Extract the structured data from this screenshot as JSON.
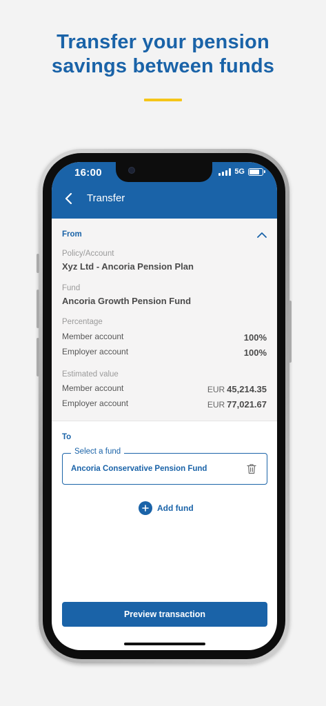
{
  "promo": {
    "headline_line1": "Transfer your pension",
    "headline_line2": "savings between funds",
    "accent_color": "#f5c518"
  },
  "status_bar": {
    "time": "16:00",
    "network": "5G"
  },
  "header": {
    "title": "Transfer",
    "back_icon": "chevron-left-icon"
  },
  "from": {
    "title": "From",
    "collapse_icon": "chevron-up-icon",
    "policy_label": "Policy/Account",
    "policy_value": "Xyz Ltd - Ancoria Pension Plan",
    "fund_label": "Fund",
    "fund_value": "Ancoria Growth Pension Fund",
    "percentage_label": "Percentage",
    "percentage_rows": [
      {
        "label": "Member account",
        "value": "100%"
      },
      {
        "label": "Employer account",
        "value": "100%"
      }
    ],
    "estimated_label": "Estimated value",
    "estimated_rows": [
      {
        "label": "Member account",
        "currency": "EUR",
        "amount": "45,214.35"
      },
      {
        "label": "Employer account",
        "currency": "EUR",
        "amount": "77,021.67"
      }
    ]
  },
  "to": {
    "title": "To",
    "select_label": "Select a fund",
    "selected_fund": "Ancoria Conservative Pension Fund",
    "delete_icon": "trash-icon",
    "add_fund_label": "Add fund",
    "add_icon": "plus-icon"
  },
  "footer": {
    "preview_button": "Preview transaction"
  },
  "colors": {
    "brand_blue": "#1a63a8",
    "section_bg": "#f5f4f4"
  }
}
